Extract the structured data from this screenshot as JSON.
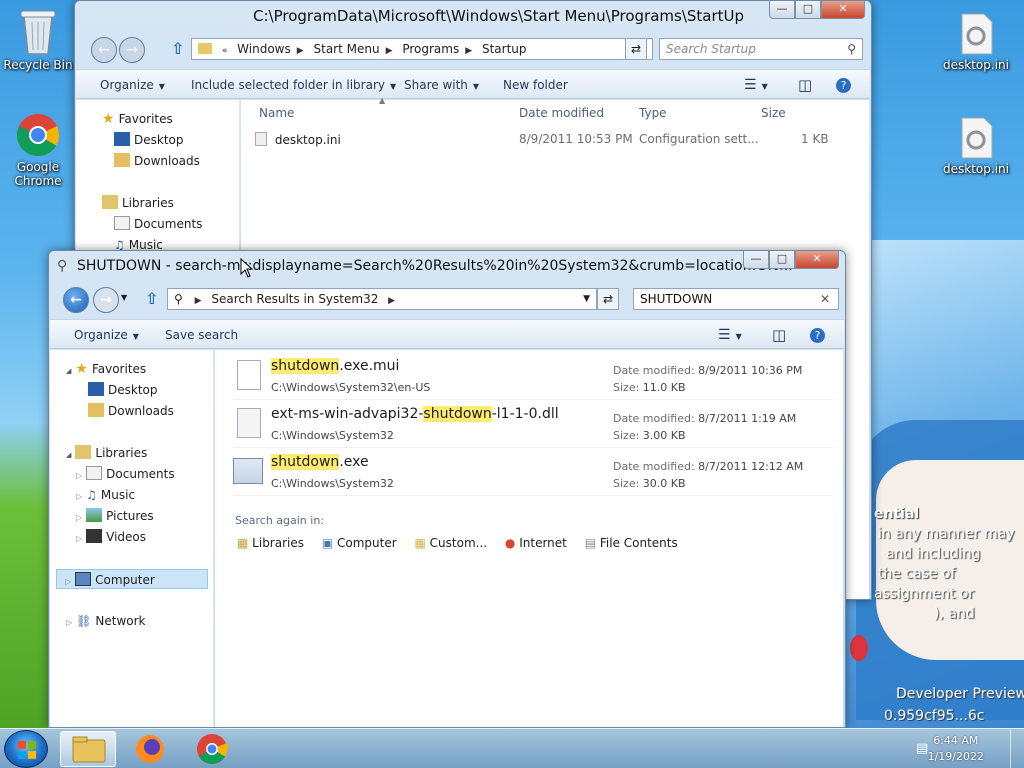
{
  "desktop": {
    "icons": {
      "recycle_bin": "Recycle Bin",
      "chrome": "Google Chrome",
      "desktop_ini_1": "desktop.ini",
      "desktop_ini_2": "desktop.ini"
    },
    "background_text": [
      "ential",
      "in any manner may",
      "and including",
      "the case of",
      "assignment or",
      "), and",
      "Developer Preview",
      "0.959cf95...6c"
    ]
  },
  "startup_window": {
    "title": "C:\\ProgramData\\Microsoft\\Windows\\Start Menu\\Programs\\StartUp",
    "breadcrumb": [
      "Windows",
      "Start Menu",
      "Programs",
      "Startup"
    ],
    "search_placeholder": "Search Startup",
    "toolbar": {
      "organize": "Organize",
      "include_library": "Include selected folder in library",
      "share_with": "Share with",
      "new_folder": "New folder"
    },
    "columns": [
      "Name",
      "Date modified",
      "Type",
      "Size"
    ],
    "files": [
      {
        "name": "desktop.ini",
        "modified": "8/9/2011 10:53 PM",
        "type": "Configuration sett...",
        "size": "1 KB"
      }
    ],
    "nav": {
      "favorites": "Favorites",
      "desktop": "Desktop",
      "downloads": "Downloads",
      "libraries": "Libraries",
      "documents": "Documents",
      "music": "Music"
    }
  },
  "search_window": {
    "title": "SHUTDOWN - search-ms:displayname=Search%20Results%20in%20System32&crumb=location:C%...",
    "breadcrumb": "Search Results in System32",
    "search_value": "SHUTDOWN",
    "toolbar": {
      "organize": "Organize",
      "save_search": "Save search"
    },
    "nav": {
      "favorites": "Favorites",
      "desktop": "Desktop",
      "downloads": "Downloads",
      "libraries": "Libraries",
      "documents": "Documents",
      "music": "Music",
      "pictures": "Pictures",
      "videos": "Videos",
      "computer": "Computer",
      "network": "Network"
    },
    "results": [
      {
        "prefix": "",
        "match": "shutdown",
        "suffix": ".exe.mui",
        "path": "C:\\Windows\\System32\\en-US",
        "modified_label": "Date modified:",
        "modified": "8/9/2011 10:36 PM",
        "size_label": "Size:",
        "size": "11.0 KB"
      },
      {
        "prefix": "ext-ms-win-advapi32-",
        "match": "shutdown",
        "suffix": "-l1-1-0.dll",
        "path": "C:\\Windows\\System32",
        "modified_label": "Date modified:",
        "modified": "8/7/2011 1:19 AM",
        "size_label": "Size:",
        "size": "3.00 KB"
      },
      {
        "prefix": "",
        "match": "shutdown",
        "suffix": ".exe",
        "path": "C:\\Windows\\System32",
        "modified_label": "Date modified:",
        "modified": "8/7/2011 12:12 AM",
        "size_label": "Size:",
        "size": "30.0 KB"
      }
    ],
    "search_again_label": "Search again in:",
    "search_again": [
      "Libraries",
      "Computer",
      "Custom...",
      "Internet",
      "File Contents"
    ]
  },
  "taskbar": {
    "time": "6:44 AM",
    "date": "1/19/2022"
  },
  "colors": {
    "highlight": "#ffec70",
    "selection": "#cce4f7",
    "titlebar": "#c3d8ee"
  }
}
